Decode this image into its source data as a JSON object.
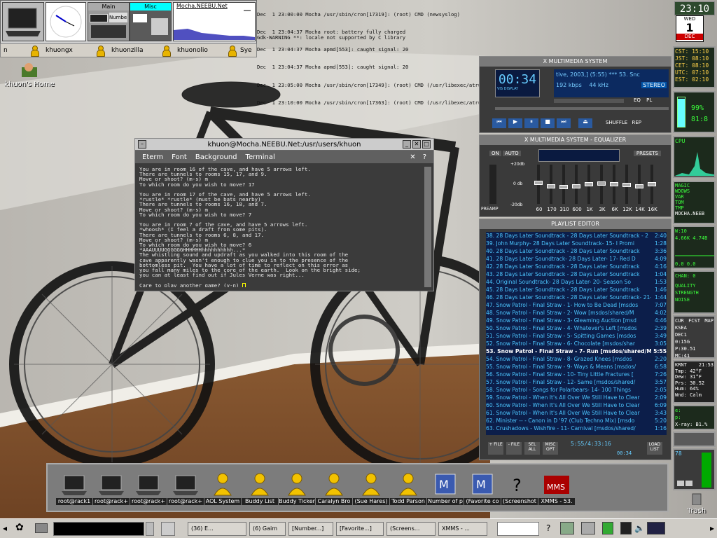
{
  "pager": {
    "main_label": "Main",
    "misc_label": "Misc",
    "net_label": "Mocha.NEEBU.Net",
    "mini_label": "Numbe"
  },
  "tasklist": [
    "n",
    "khuongx",
    "khuonzilla",
    "khuonolio",
    "Sye"
  ],
  "log_lines": [
    "Dec  1 23:00:00 Mocha /usr/sbin/cron[17319]: (root) CMD (newsyslog)",
    "Dec  1 23:04:37 Mocha root: battery fully charged",
    "Dec  1 23:04:37 Mocha apmd[553]: caught signal: 20",
    "Dec  1 23:04:37 Mocha apmd[553]: caught signal: 20",
    "Dec  1 23:05:00 Mocha /usr/sbin/cron[17349]: (root) CMD (/usr/libexec/atrun)",
    "Dec  1 23:10:00 Mocha /usr/sbin/cron[17363]: (root) CMD (/usr/libexec/atrun)"
  ],
  "gdk_warning": "Gdk-WARNING **: locale not supported by C library",
  "desktop": {
    "home_label": "khuon's Home",
    "trash_label": "Trash"
  },
  "clock": {
    "time": "23:10",
    "weekday": "WED",
    "day": "1",
    "month": "DEC"
  },
  "worldclock": [
    "CST: 15:10",
    "JST: 08:10",
    "CET: 08:10",
    "UTC: 07:10",
    "EST: 02:10"
  ],
  "battery": {
    "percent": "99%",
    "time": "81:8"
  },
  "cpu_label": "CPU",
  "magic_lines": [
    "MAGIC",
    "WDOWS",
    "VAR",
    "TOM",
    "TMP",
    "MOCHA.NEEB"
  ],
  "wifi": {
    "label": "W:10",
    "rate": "4.66K 4.74B",
    "value": "0.0 0.0"
  },
  "chan": "CHAN: 0",
  "quality": [
    "QUALITY",
    "STRENGTH",
    "NOISE"
  ],
  "weather_tabs": [
    "CUR",
    "FCST",
    "MAP"
  ],
  "weather": {
    "station": "KSEA",
    "date": "DEC1",
    "temp": "0:15G",
    "time": "P:30.51",
    "extra": "MC:41"
  },
  "krnt": {
    "station": "KRNT",
    "time": "21:53",
    "tmp": "Tmp: 42°F",
    "dew": "Dew: 31°F",
    "prs": "Prs: 30.52",
    "hum": "Hum: 64%",
    "wnd": "Wnd: Calm"
  },
  "xray": {
    "e": "e: ",
    "p": "p: ",
    "label": "X-ray: B1.%"
  },
  "vol": "78",
  "eterm": {
    "title": "khuon@Mocha.NEEBU.Net:/usr/users/khuon",
    "menu": [
      "Eterm",
      "Font",
      "Background",
      "Terminal"
    ],
    "lines": [
      "You are in room 16 of the cave, and have 5 arrows left.",
      "There are tunnels to rooms 15, 17, and 9.",
      "Move or shoot? (m-s) m",
      "To which room do you wish to move? 17",
      "",
      "You are in room 17 of the cave, and have 5 arrows left.",
      "*rustle* *rustle* (must be bats nearby)",
      "There are tunnels to rooms 16, 18, and 7.",
      "Move or shoot? (m-s) m",
      "To which room do you wish to move? 7",
      "",
      "You are in room 7 of the cave, and have 5 arrows left.",
      "*whoosh* (I feel a draft from some pits).",
      "There are tunnels to rooms 6, 8, and 17.",
      "Move or shoot? (m-s) m",
      "To which room do you wish to move? 6",
      "*AAAUUUUGGGGGGHHHHHHhhhhhhhhhh...*",
      "The whistling sound and updraft as you walked into this room of the",
      "cave apparently wasn't enough to clue you in to the presence of the",
      "bottomless pit.  You have a lot of time to reflect on this error as",
      "you fall many miles to the core of the earth.  Look on the bright side;",
      "you can at least find out if Jules Verne was right...",
      "",
      "Care to play another game? (y-n) "
    ]
  },
  "xmms": {
    "title": "X MULTIMEDIA SYSTEM",
    "time": "00:34",
    "song": "tive, 2003,] (5:55)  ***  53. Snc",
    "kbps": "192 kbps",
    "khz": "44 kHz",
    "stereo": "STEREO",
    "eq_btn": "EQ",
    "pl_btn": "PL",
    "shuffle": "SHUFFLE",
    "rep": "REP",
    "vis": "VIS DISPLAY"
  },
  "eq": {
    "title": "X MULTIMEDIA SYSTEM - EQUALIZER",
    "on": "ON",
    "auto": "AUTO",
    "presets": "PRESETS",
    "db_top": "+20db",
    "db_mid": "0 db",
    "db_bot": "-20db",
    "preamp": "PREAMP",
    "bands": [
      "60",
      "170",
      "310",
      "600",
      "1K",
      "3K",
      "6K",
      "12K",
      "14K",
      "16K"
    ],
    "levels": [
      0.45,
      0.55,
      0.58,
      0.55,
      0.5,
      0.48,
      0.5,
      0.52,
      0.55,
      0.5
    ]
  },
  "playlist": {
    "title": "PLAYLIST EDITOR",
    "rows": [
      {
        "t": "38. 28 Days Later Soundtrack - 28 Days Later Soundtrack - 2",
        "d": "2:40"
      },
      {
        "t": "39. John Murphy- 28 Days Later Soundtrack- 15- I Promi",
        "d": "1:28"
      },
      {
        "t": "40. 28 Days Later Soundtrack - 28 Days Later Soundtrack",
        "d": "3:36"
      },
      {
        "t": "41. 28 Days Later Soundtrack- 28 Days Later- 17- Red D",
        "d": "4:09"
      },
      {
        "t": "42. 28 Days Later Soundtrack - 28 Days Later Soundtrack",
        "d": "4:16"
      },
      {
        "t": "43. 28 Days Later Soundtrack - 28 Days Later Soundtrack",
        "d": "1:04"
      },
      {
        "t": "44. Original Soundtrack- 28 Days Later- 20- Season So",
        "d": "1:53"
      },
      {
        "t": "45. 28 Days Later Soundtrack - 28 Days Later Soundtrack",
        "d": "1:46"
      },
      {
        "t": "46. 28 Days Later Soundtrack - 28 Days Later Soundtrack- 21- 28 Da",
        "d": "1:44"
      },
      {
        "t": "47. Snow Patrol - Final Straw - 1- How to Be Dead [msdos",
        "d": "7:07"
      },
      {
        "t": "48. Snow Patrol - Final Straw - 2- Wow [msdos/shared/M",
        "d": "4:02"
      },
      {
        "t": "49. Snow Patrol - Final Straw - 3- Gleaming Auction [msd",
        "d": "4:46"
      },
      {
        "t": "50. Snow Patrol - Final Straw - 4- Whatever's Left [msdos",
        "d": "2:39"
      },
      {
        "t": "51. Snow Patrol - Final Straw - 5- Spitting Games [msdos",
        "d": "3:49"
      },
      {
        "t": "52. Snow Patrol - Final Straw - 6- Chocolate [msdos/shar",
        "d": "3:05"
      },
      {
        "t": "53. Snow Patrol - Final Straw - 7- Run [msdos/shared/Mu",
        "d": "5:55"
      },
      {
        "t": "54. Snow Patrol - Final Straw - 8- Grazed Knees [msdos",
        "d": "2:20"
      },
      {
        "t": "55. Snow Patrol - Final Straw - 9- Ways & Means [msdos/",
        "d": "6:58"
      },
      {
        "t": "56. Snow Patrol - Final Straw - 10- Tiny Little Fractures [",
        "d": "7:26"
      },
      {
        "t": "57. Snow Patrol - Final Straw - 12- Same [msdos/shared/",
        "d": "3:57"
      },
      {
        "t": "58. Snow Patrol - Songs for Polarbears- 14- 100 Things",
        "d": "2:05"
      },
      {
        "t": "59. Snow Patrol - When It's All Over We Still Have to Clear",
        "d": "2:09"
      },
      {
        "t": "60. Snow Patrol - When It's All Over We Still Have to Clear",
        "d": "6:09"
      },
      {
        "t": "61. Snow Patrol - When It's All Over We Still Have to Clear",
        "d": "3:43"
      },
      {
        "t": "62. Minister -- - Canon in D '97 (Club Techno Mix) [msdo",
        "d": "5:20"
      },
      {
        "t": "63. Crushadows - Wishfire - 11- Carnival [msdos/shared/",
        "d": "1:16"
      }
    ],
    "selected_index": 15,
    "buttons": [
      "+ FILE",
      "- FILE",
      "SEL ALL",
      "MISC OPT"
    ],
    "time_info": "5:55/4:33:16",
    "time_small": "00:34",
    "load_list": "LOAD LIST"
  },
  "launcher": [
    "root@rack1",
    "root@rack+",
    "root@rack+",
    "root@rack+",
    "AOL System",
    "Buddy List",
    "Buddy Ticker",
    "Caralyn Bro",
    "(Sue Hares)",
    "Todd Parson",
    "Number of p",
    "(Favorite co",
    "(Screenshot",
    "XMMS - 53."
  ],
  "taskbar": [
    "(36) E...",
    "(6) Gaim",
    "[Number...]",
    "[Favorite...]",
    "(Screens...",
    "XMMS - ..."
  ]
}
